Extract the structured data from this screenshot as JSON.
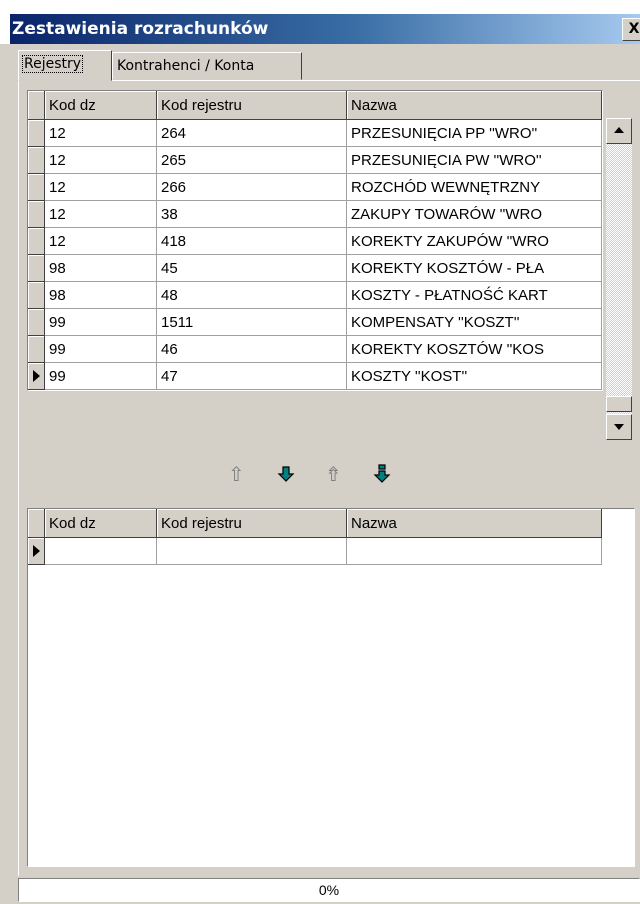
{
  "window": {
    "title": "Zestawienia rozrachunków",
    "close_label": "X"
  },
  "tabs": [
    {
      "label": "Rejestry",
      "active": true
    },
    {
      "label": "Kontrahenci / Konta",
      "active": false
    }
  ],
  "top_grid": {
    "columns": [
      "Kod dz",
      "Kod rejestru",
      "Nazwa"
    ],
    "rows": [
      [
        "12",
        "264",
        "PRZESUNIĘCIA PP ''WRO''"
      ],
      [
        "12",
        "265",
        "PRZESUNIĘCIA PW ''WRO''"
      ],
      [
        "12",
        "266",
        "ROZCHÓD WEWNĘTRZNY"
      ],
      [
        "12",
        "38",
        "ZAKUPY TOWARÓW ''WRO"
      ],
      [
        "12",
        "418",
        "KOREKTY ZAKUPÓW ''WRO"
      ],
      [
        "98",
        "45",
        "KOREKTY KOSZTÓW - PŁA"
      ],
      [
        "98",
        "48",
        "KOSZTY - PŁATNOŚĆ KART"
      ],
      [
        "99",
        "1511",
        "KOMPENSATY ''KOSZT''"
      ],
      [
        "99",
        "46",
        "KOREKTY KOSZTÓW ''KOS"
      ],
      [
        "99",
        "47",
        "KOSZTY ''KOST''"
      ]
    ],
    "current_row": 9
  },
  "transfer_buttons": {
    "icons": [
      "outline-up-arrow-icon",
      "down-arrow-icon",
      "outline-double-up-arrow-icon",
      "double-down-arrow-icon"
    ],
    "color": "#008080"
  },
  "bottom_grid": {
    "columns": [
      "Kod dz",
      "Kod rejestru",
      "Nazwa"
    ]
  },
  "progress": {
    "text": "0%",
    "value": 0
  }
}
